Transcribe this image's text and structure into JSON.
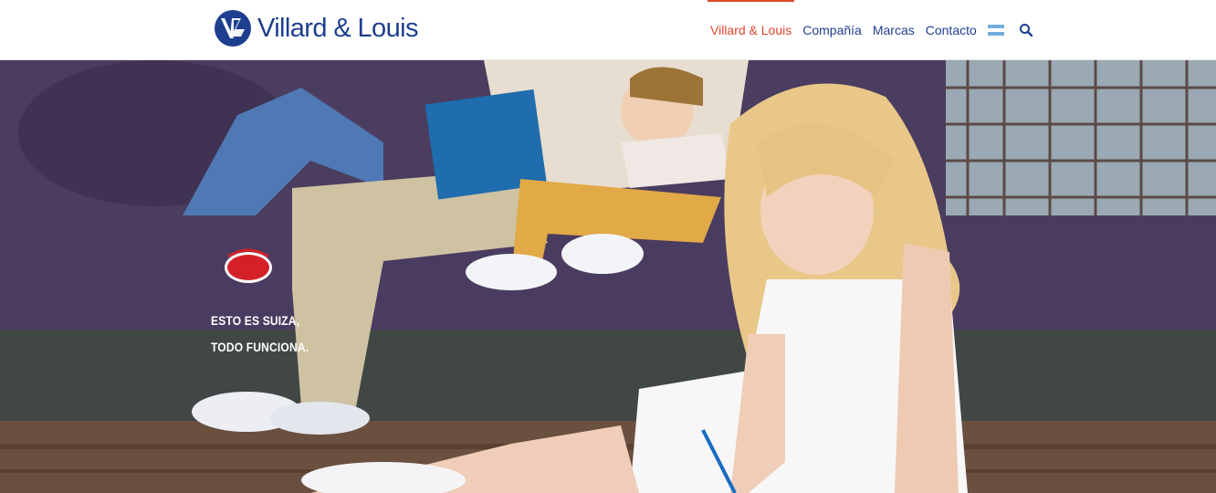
{
  "header": {
    "brand": "Villard & Louis",
    "nav": [
      {
        "label": "Villard & Louis",
        "active": true
      },
      {
        "label": "Compañía",
        "active": false
      },
      {
        "label": "Marcas",
        "active": false
      },
      {
        "label": "Contacto",
        "active": false
      }
    ],
    "flag_icon": "argentina-flag-icon",
    "search_icon": "search-icon"
  },
  "hero": {
    "brand_badge": "Suiza",
    "tagline_line1": "ESTO ES SUIZA,",
    "tagline_line2": "TODO FUNCIONA."
  },
  "colors": {
    "brand_blue": "#1e3f8f",
    "accent_red": "#e1472b",
    "sofa_purple": "#4a3d5c"
  }
}
